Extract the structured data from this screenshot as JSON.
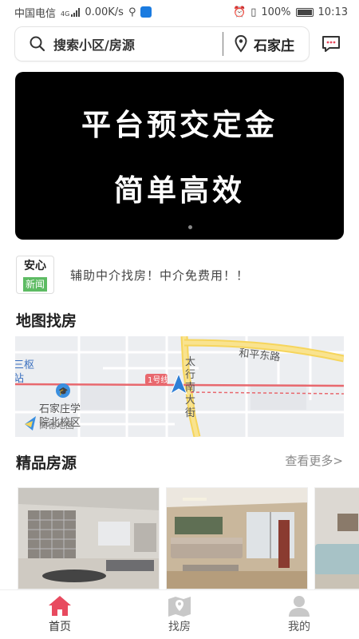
{
  "status_bar": {
    "carrier": "中国电信",
    "network": "4G",
    "speed": "0.00K/s",
    "battery": "100%",
    "time": "10:13"
  },
  "search": {
    "placeholder": "搜索小区/房源",
    "city": "石家庄"
  },
  "banner": {
    "line1": "平台预交定金",
    "line2": "简单高效"
  },
  "news": {
    "badge_top": "安心",
    "badge_bottom": "新闻",
    "text": "辅助中介找房！中介免费用！！"
  },
  "map_section": {
    "title": "地图找房",
    "labels": {
      "road_east": "和平东路",
      "road_south": "太行南大街",
      "line": "1号线",
      "station": "三枢站",
      "school": "石家庄学院北校区",
      "logo": "高德地图"
    },
    "colors": {
      "road_main": "#f6d55c",
      "metro": "#e8686e",
      "marker": "#2f7fd6"
    }
  },
  "listings_section": {
    "title": "精品房源",
    "more": "查看更多>",
    "cards": [
      {
        "name": "listing-1"
      },
      {
        "name": "listing-2"
      },
      {
        "name": "listing-3"
      }
    ]
  },
  "tabbar": {
    "items": [
      {
        "label": "首页",
        "icon": "home-icon",
        "active": true
      },
      {
        "label": "找房",
        "icon": "map-icon",
        "active": false
      },
      {
        "label": "我的",
        "icon": "user-icon",
        "active": false
      }
    ],
    "active_color": "#e84a5f",
    "inactive_color": "#c8c8c8"
  }
}
